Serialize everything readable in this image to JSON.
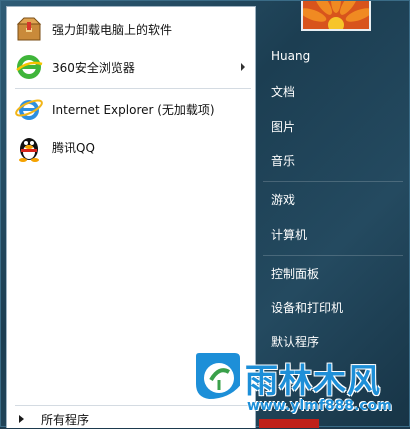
{
  "programs": [
    {
      "label": "强力卸载电脑上的软件",
      "icon": "uninstaller-box-icon"
    },
    {
      "label": "360安全浏览器",
      "icon": "360-browser-icon",
      "has_submenu": true
    },
    {
      "label": "Internet Explorer (无加载项)",
      "icon": "internet-explorer-icon"
    },
    {
      "label": "腾讯QQ",
      "icon": "qq-penguin-icon"
    }
  ],
  "all_programs_label": "所有程序",
  "user": {
    "picture": "flower"
  },
  "right_links": [
    {
      "label": "Huang"
    },
    {
      "label": "文档"
    },
    {
      "label": "图片"
    },
    {
      "label": "音乐"
    },
    {
      "label": "游戏"
    },
    {
      "label": "计算机"
    },
    {
      "label": "控制面板"
    },
    {
      "label": "设备和打印机"
    },
    {
      "label": "默认程序"
    }
  ],
  "watermark": {
    "name": "雨林木风",
    "url": "www.ylmf888.com"
  },
  "colors": {
    "accent": "#1d8fd8",
    "right_pane": "#244a60"
  }
}
